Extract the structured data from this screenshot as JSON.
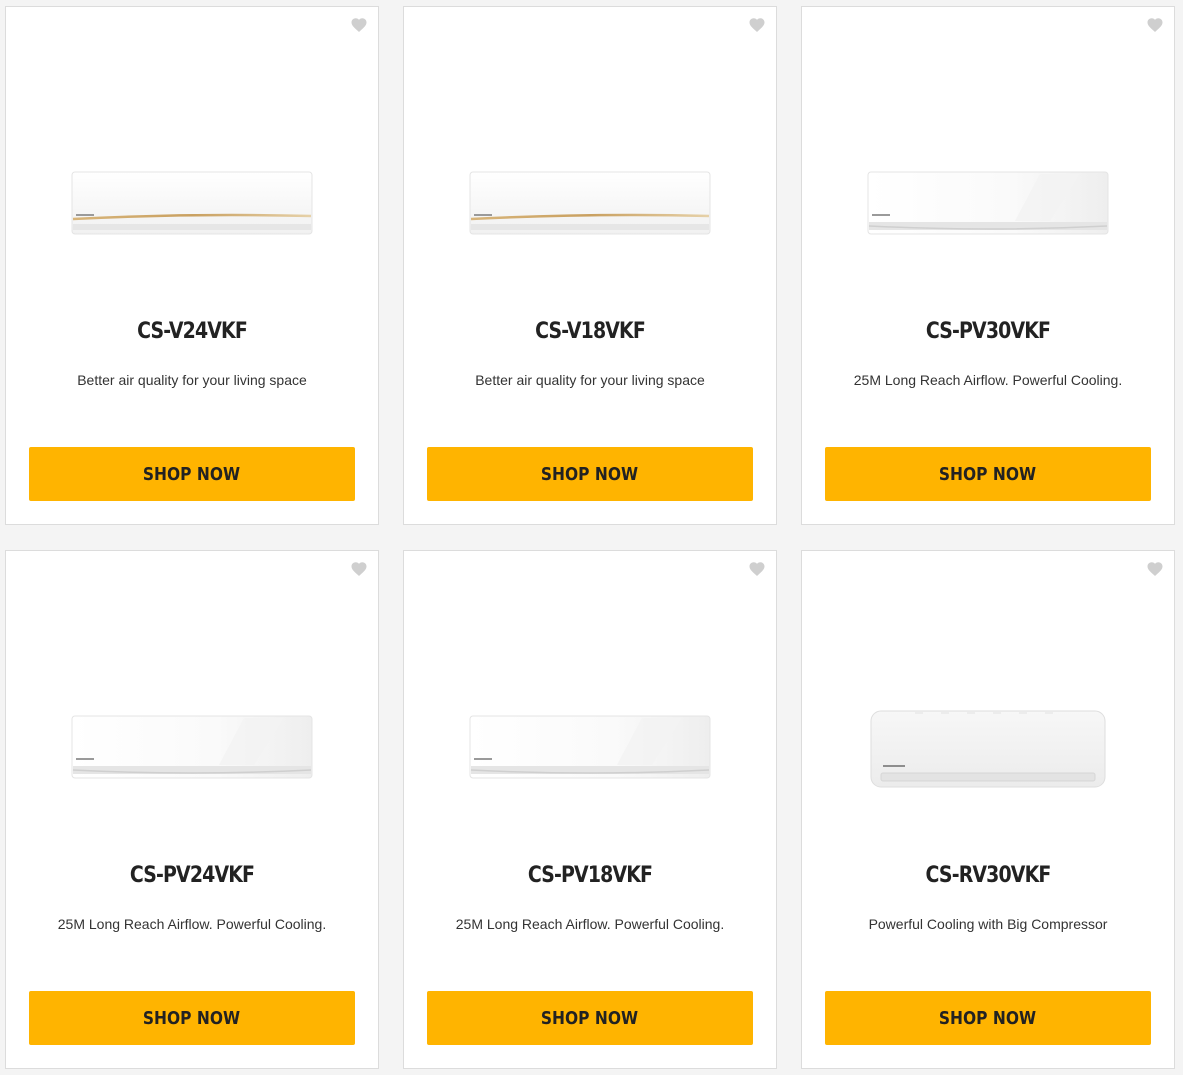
{
  "colors": {
    "accent": "#ffb400",
    "page_background": "#f4f4f4",
    "card_background": "#ffffff",
    "heart": "#cfcfcf"
  },
  "products": [
    {
      "name": "CS-V24VKF",
      "description": "Better air quality for your living space",
      "button_label": "SHOP NOW",
      "image_variant": "gold-stripe",
      "favorite_icon": "heart-icon"
    },
    {
      "name": "CS-V18VKF",
      "description": "Better air quality for your living space",
      "button_label": "SHOP NOW",
      "image_variant": "gold-stripe",
      "favorite_icon": "heart-icon"
    },
    {
      "name": "CS-PV30VKF",
      "description": "25M Long Reach Airflow. Powerful Cooling.",
      "button_label": "SHOP NOW",
      "image_variant": "glossy",
      "favorite_icon": "heart-icon"
    },
    {
      "name": "CS-PV24VKF",
      "description": "25M Long Reach Airflow. Powerful Cooling.",
      "button_label": "SHOP NOW",
      "image_variant": "glossy",
      "favorite_icon": "heart-icon"
    },
    {
      "name": "CS-PV18VKF",
      "description": "25M Long Reach Airflow. Powerful Cooling.",
      "button_label": "SHOP NOW",
      "image_variant": "glossy",
      "favorite_icon": "heart-icon"
    },
    {
      "name": "CS-RV30VKF",
      "description": "Powerful Cooling with Big Compressor",
      "button_label": "SHOP NOW",
      "image_variant": "rounded",
      "favorite_icon": "heart-icon"
    }
  ]
}
